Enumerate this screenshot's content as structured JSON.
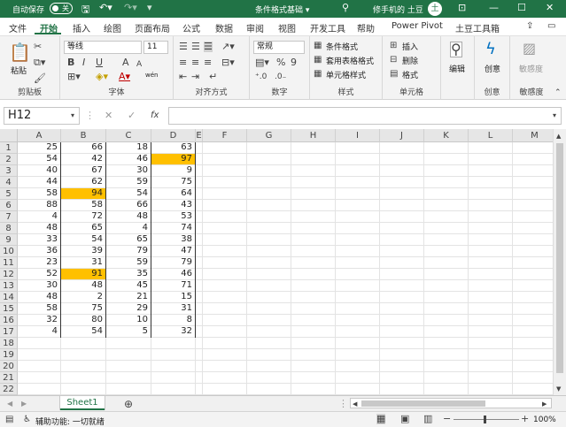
{
  "titlebar": {
    "autosave_label": "自动保存",
    "autosave_state": "关",
    "doc_title": "条件格式基础 ▾",
    "user_name": "修手机的 土豆",
    "avatar_text": "土"
  },
  "menu": {
    "tabs": [
      "文件",
      "开始",
      "插入",
      "绘图",
      "页面布局",
      "公式",
      "数据",
      "审阅",
      "视图",
      "开发工具",
      "帮助",
      "Power Pivot",
      "土豆工具箱"
    ],
    "active_tab": "开始"
  },
  "ribbon": {
    "clipboard": {
      "paste": "粘贴",
      "label": "剪贴板"
    },
    "font": {
      "name": "等线",
      "size": "11",
      "bold": "B",
      "italic": "I",
      "underline": "U",
      "grow": "A",
      "shrink": "A",
      "wen": "wén",
      "label": "字体"
    },
    "alignment": {
      "label": "对齐方式"
    },
    "number": {
      "format": "常规",
      "percent": "%",
      "label": "数字"
    },
    "styles": {
      "conditional": "条件格式",
      "table": "套用表格格式",
      "cell": "单元格样式",
      "label": "样式"
    },
    "cells": {
      "insert": "插入",
      "delete": "删除",
      "format": "格式",
      "label": "单元格"
    },
    "editing": {
      "label": "编辑"
    },
    "create": {
      "label": "创意",
      "btn": "创意"
    },
    "sensitivity": {
      "label": "敏感度",
      "btn": "敏感度"
    }
  },
  "formula_bar": {
    "name_box": "H12",
    "fx": "fx",
    "cancel": "✕",
    "enter": "✓",
    "value": ""
  },
  "columns": [
    "A",
    "B",
    "C",
    "D",
    "E",
    "F",
    "G",
    "H",
    "I",
    "J",
    "K",
    "L",
    "M"
  ],
  "rows": [
    "1",
    "2",
    "3",
    "4",
    "5",
    "6",
    "7",
    "8",
    "9",
    "10",
    "11",
    "12",
    "13",
    "14",
    "15",
    "16",
    "17",
    "18",
    "19",
    "20",
    "21",
    "22"
  ],
  "data": [
    [
      25,
      66,
      18,
      63
    ],
    [
      54,
      42,
      46,
      97
    ],
    [
      40,
      67,
      30,
      9
    ],
    [
      44,
      62,
      59,
      75
    ],
    [
      58,
      94,
      54,
      64
    ],
    [
      88,
      58,
      66,
      43
    ],
    [
      4,
      72,
      48,
      53
    ],
    [
      48,
      65,
      4,
      74
    ],
    [
      33,
      54,
      65,
      38
    ],
    [
      36,
      39,
      79,
      47
    ],
    [
      23,
      31,
      59,
      79
    ],
    [
      52,
      91,
      35,
      46
    ],
    [
      30,
      48,
      45,
      71
    ],
    [
      48,
      2,
      21,
      15
    ],
    [
      58,
      75,
      29,
      31
    ],
    [
      32,
      80,
      10,
      8
    ],
    [
      4,
      54,
      5,
      32
    ]
  ],
  "highlights": [
    [
      1,
      3
    ],
    [
      4,
      1
    ],
    [
      11,
      1
    ]
  ],
  "highlight_color": "#ffc000",
  "accent_color": "#217346",
  "sheets": [
    "Sheet1"
  ],
  "status": {
    "accessibility": "辅助功能: 一切就绪",
    "zoom": "100%"
  }
}
